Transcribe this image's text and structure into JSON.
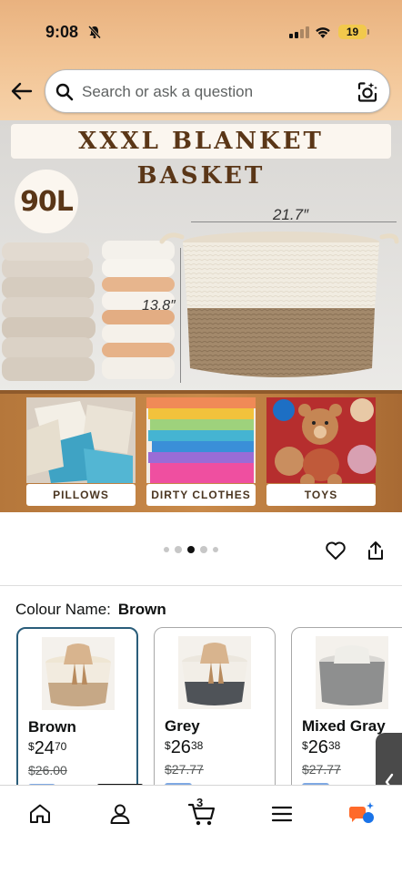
{
  "status_bar": {
    "time": "9:08",
    "battery": "19"
  },
  "search": {
    "placeholder": "Search or ask a question"
  },
  "product_image": {
    "title": "XXXL BLANKET BASKET",
    "volume": "90L",
    "width_label": "21.7″",
    "height_label": "13.8″",
    "use_cases": [
      "PILLOWS",
      "DIRTY CLOTHES",
      "TOYS"
    ]
  },
  "gallery": {
    "total_images": 5,
    "active_index": 2
  },
  "colour": {
    "label": "Colour Name:",
    "selected": "Brown",
    "options": [
      {
        "name": "Brown",
        "currency": "$",
        "price_whole": "24",
        "price_fraction": "70",
        "was_price": "$26.00"
      },
      {
        "name": "Grey",
        "currency": "$",
        "price_whole": "26",
        "price_fraction": "38",
        "was_price": "$27.77"
      },
      {
        "name": "Mixed Gray",
        "currency": "$",
        "price_whole": "26",
        "price_fraction": "38",
        "was_price": "$27.77"
      }
    ]
  },
  "bottom_nav": {
    "cart_count": "3"
  },
  "colors": {
    "header": "#f2c596",
    "accent_blue": "#2a5d7a",
    "ai_orange": "#ff6a2a",
    "ai_blue": "#1a73e8"
  }
}
